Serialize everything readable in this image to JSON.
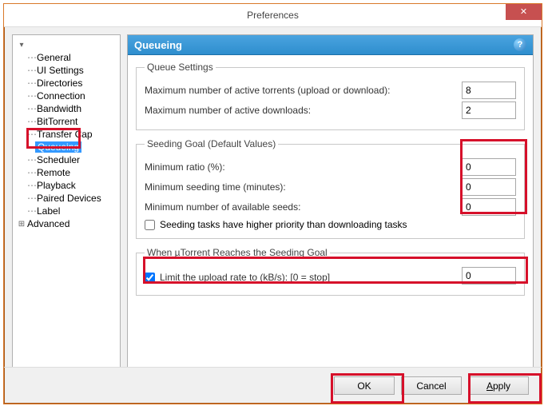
{
  "window": {
    "title": "Preferences"
  },
  "sidebar": {
    "items": [
      {
        "label": "General"
      },
      {
        "label": "UI Settings"
      },
      {
        "label": "Directories"
      },
      {
        "label": "Connection"
      },
      {
        "label": "Bandwidth"
      },
      {
        "label": "BitTorrent"
      },
      {
        "label": "Transfer Cap"
      },
      {
        "label": "Queueing",
        "selected": true
      },
      {
        "label": "Scheduler"
      },
      {
        "label": "Remote"
      },
      {
        "label": "Playback"
      },
      {
        "label": "Paired Devices"
      },
      {
        "label": "Label"
      },
      {
        "label": "Advanced",
        "expandable": true
      }
    ]
  },
  "page": {
    "header": "Queueing",
    "sections": {
      "queue": {
        "legend": "Queue Settings",
        "maxActiveLabel": "Maximum number of active torrents (upload or download):",
        "maxActiveValue": "8",
        "maxDownLabel": "Maximum number of active downloads:",
        "maxDownValue": "2"
      },
      "seeding": {
        "legend": "Seeding Goal (Default Values)",
        "ratioLabel": "Minimum ratio (%):",
        "ratioValue": "0",
        "timeLabel": "Minimum seeding time (minutes):",
        "timeValue": "0",
        "seedsLabel": "Minimum number of available seeds:",
        "seedsValue": "0",
        "priorityLabel": "Seeding tasks have higher priority than downloading tasks",
        "priorityChecked": false
      },
      "reached": {
        "legend": "When µTorrent Reaches the Seeding Goal",
        "limitLabel": "Limit the upload rate to (kB/s): [0 = stop]",
        "limitChecked": true,
        "limitValue": "0"
      }
    }
  },
  "buttons": {
    "ok": "OK",
    "cancel": "Cancel",
    "apply": "Apply"
  }
}
